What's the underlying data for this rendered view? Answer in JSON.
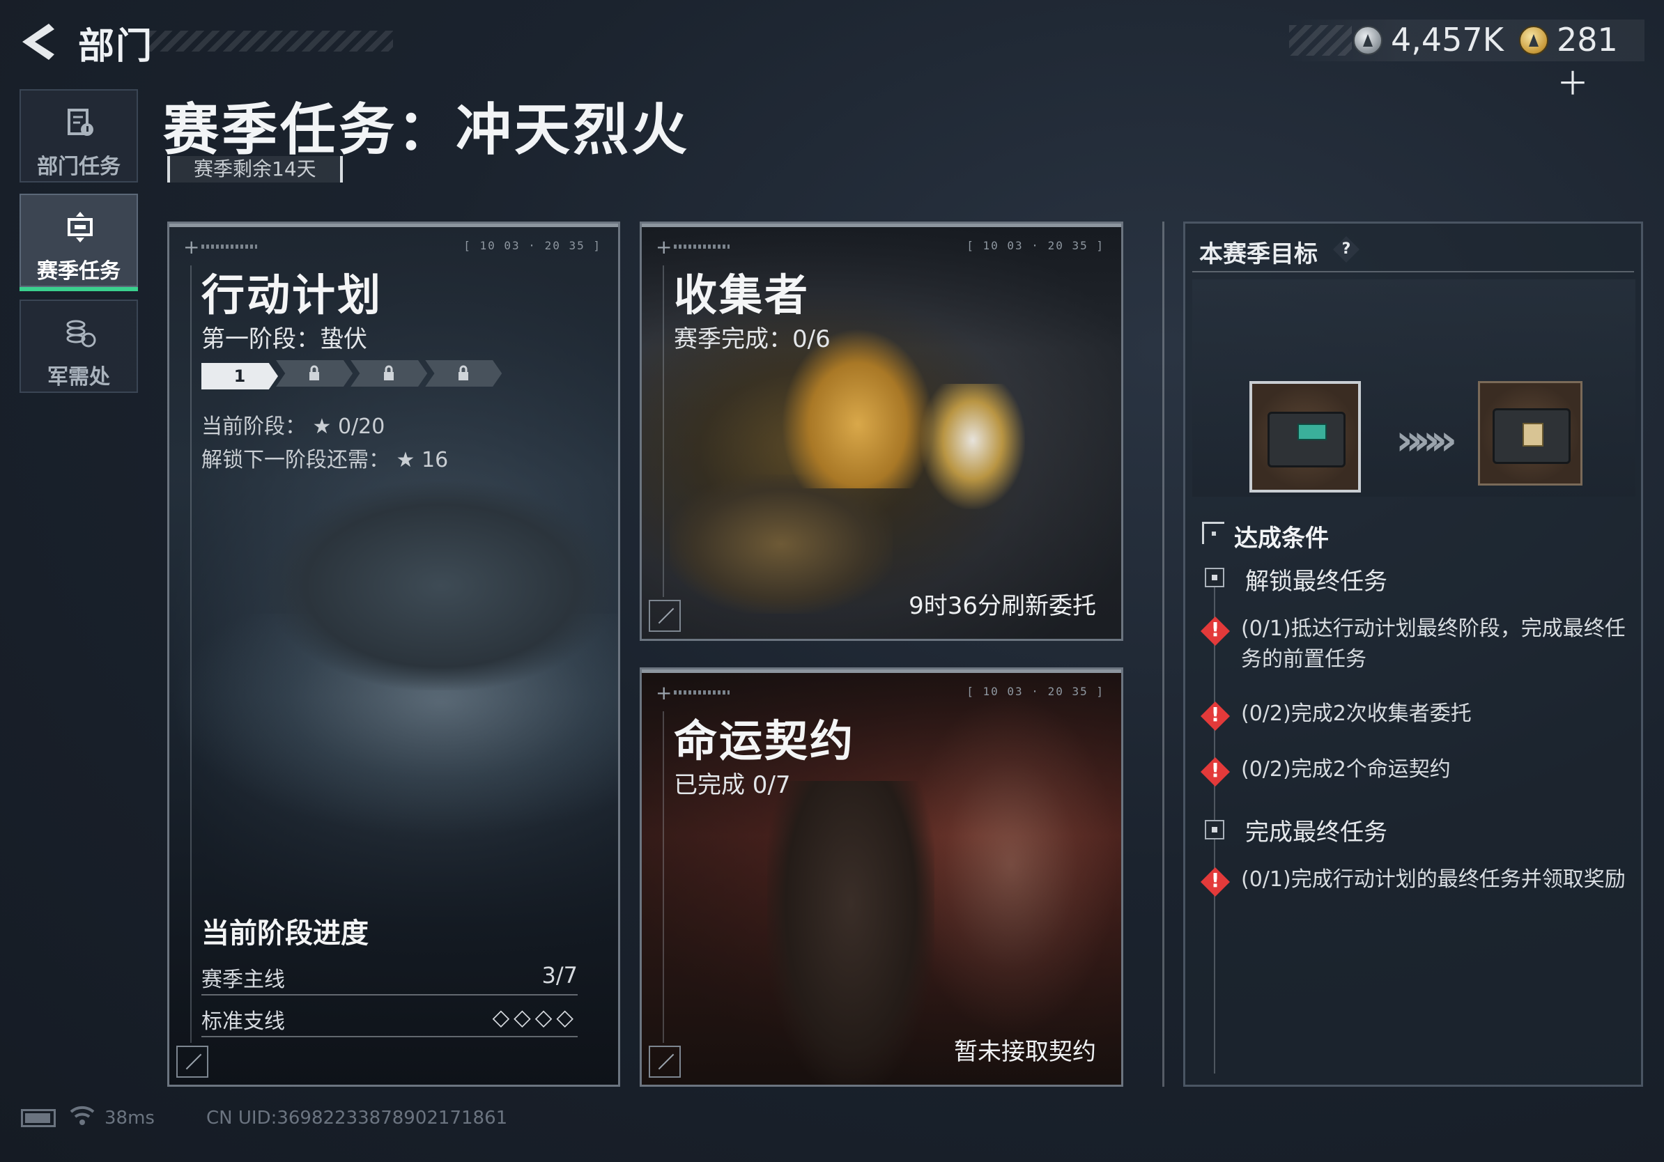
{
  "header": {
    "title": "部门",
    "back_icon": "back-arrow-icon",
    "currencies": [
      {
        "icon": "silver-coin-icon",
        "value": "4,457K"
      },
      {
        "icon": "gold-coin-icon",
        "value": "281＋"
      }
    ]
  },
  "nav": {
    "items": [
      {
        "label": "部门任务",
        "icon": "department-task-icon",
        "active": false
      },
      {
        "label": "赛季任务",
        "icon": "season-task-icon",
        "active": true
      },
      {
        "label": "军需处",
        "icon": "quartermaster-icon",
        "active": false
      }
    ],
    "active_color": "#3ad08e"
  },
  "page": {
    "title": "赛季任务：冲天烈火",
    "season_remaining": "赛季剩余14天"
  },
  "cards": {
    "operation": {
      "title": "行动计划",
      "stage": "第一阶段：蛰伏",
      "stages": [
        "1",
        "🔒",
        "🔒",
        "🔒"
      ],
      "current_stage_label": "当前阶段：",
      "current_stage_value": "★ 0/20",
      "unlock_label": "解锁下一阶段还需：",
      "unlock_value": "★ 16",
      "progress_title": "当前阶段进度",
      "rows": [
        {
          "label": "赛季主线",
          "value": "3/7"
        },
        {
          "label": "标准支线",
          "value": "◇◇◇◇"
        }
      ]
    },
    "collector": {
      "title": "收集者",
      "subtitle": "赛季完成：0/6",
      "refresh": "9时36分刷新委托"
    },
    "fate": {
      "title": "命运契约",
      "subtitle": "已完成 0/7",
      "status": "暂未接取契约"
    }
  },
  "goals": {
    "title": "本赛季目标",
    "help": "?",
    "items": [
      {
        "icon": "crate-teal-icon",
        "selected": true
      },
      {
        "icon": "crate-gold-icon",
        "selected": false
      }
    ],
    "arrow": "»»»",
    "conditions_title": "达成条件",
    "groups": [
      {
        "label": "解锁最终任务",
        "subs": [
          "(0/1)抵达行动计划最终阶段，完成最终任务的前置任务",
          "(0/2)完成2次收集者委托",
          "(0/2)完成2个命运契约"
        ]
      },
      {
        "label": "完成最终任务",
        "subs": [
          "(0/1)完成行动计划的最终任务并领取奖励"
        ]
      }
    ],
    "warn_color": "#e33a3a"
  },
  "footer": {
    "latency": "38ms",
    "uid": "CN UID:36982233878902171861"
  }
}
